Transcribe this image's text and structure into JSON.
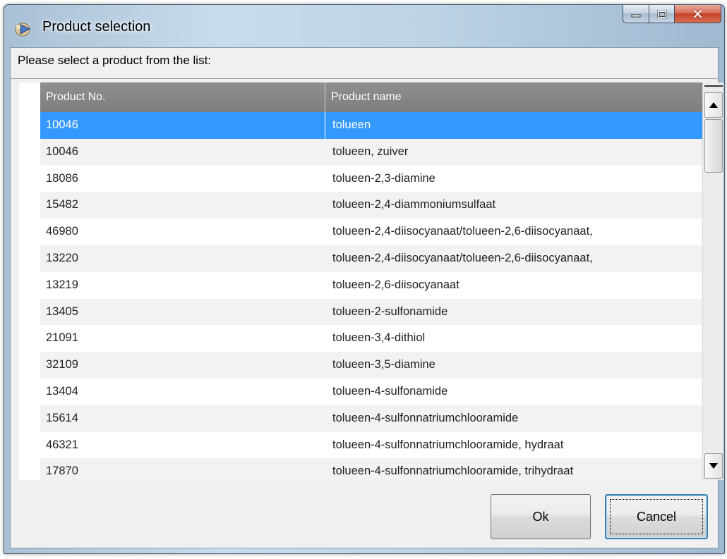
{
  "window": {
    "title": "Product selection"
  },
  "prompt": "Please select a product from the list:",
  "table": {
    "columns": [
      "Product No.",
      "Product name"
    ],
    "selected_index": 0,
    "rows": [
      {
        "no": "10046",
        "name": "tolueen"
      },
      {
        "no": "10046",
        "name": "tolueen, zuiver"
      },
      {
        "no": "18086",
        "name": "tolueen-2,3-diamine"
      },
      {
        "no": "15482",
        "name": "tolueen-2,4-diammoniumsulfaat"
      },
      {
        "no": "46980",
        "name": "tolueen-2,4-diisocyanaat/tolueen-2,6-diisocyanaat,"
      },
      {
        "no": "13220",
        "name": "tolueen-2,4-diisocyanaat/tolueen-2,6-diisocyanaat,"
      },
      {
        "no": "13219",
        "name": "tolueen-2,6-diisocyanaat"
      },
      {
        "no": "13405",
        "name": "tolueen-2-sulfonamide"
      },
      {
        "no": "21091",
        "name": "tolueen-3,4-dithiol"
      },
      {
        "no": "32109",
        "name": "tolueen-3,5-diamine"
      },
      {
        "no": "13404",
        "name": "tolueen-4-sulfonamide"
      },
      {
        "no": "15614",
        "name": "tolueen-4-sulfonnatriumchlooramide"
      },
      {
        "no": "46321",
        "name": "tolueen-4-sulfonnatriumchlooramide, hydraat"
      },
      {
        "no": "17870",
        "name": "tolueen-4-sulfonnatriumchlooramide, trihydraat"
      }
    ]
  },
  "buttons": {
    "ok": "Ok",
    "cancel": "Cancel"
  },
  "colors": {
    "selection": "#3399ff",
    "header_bg": "#878787",
    "close_button": "#c4442a"
  }
}
